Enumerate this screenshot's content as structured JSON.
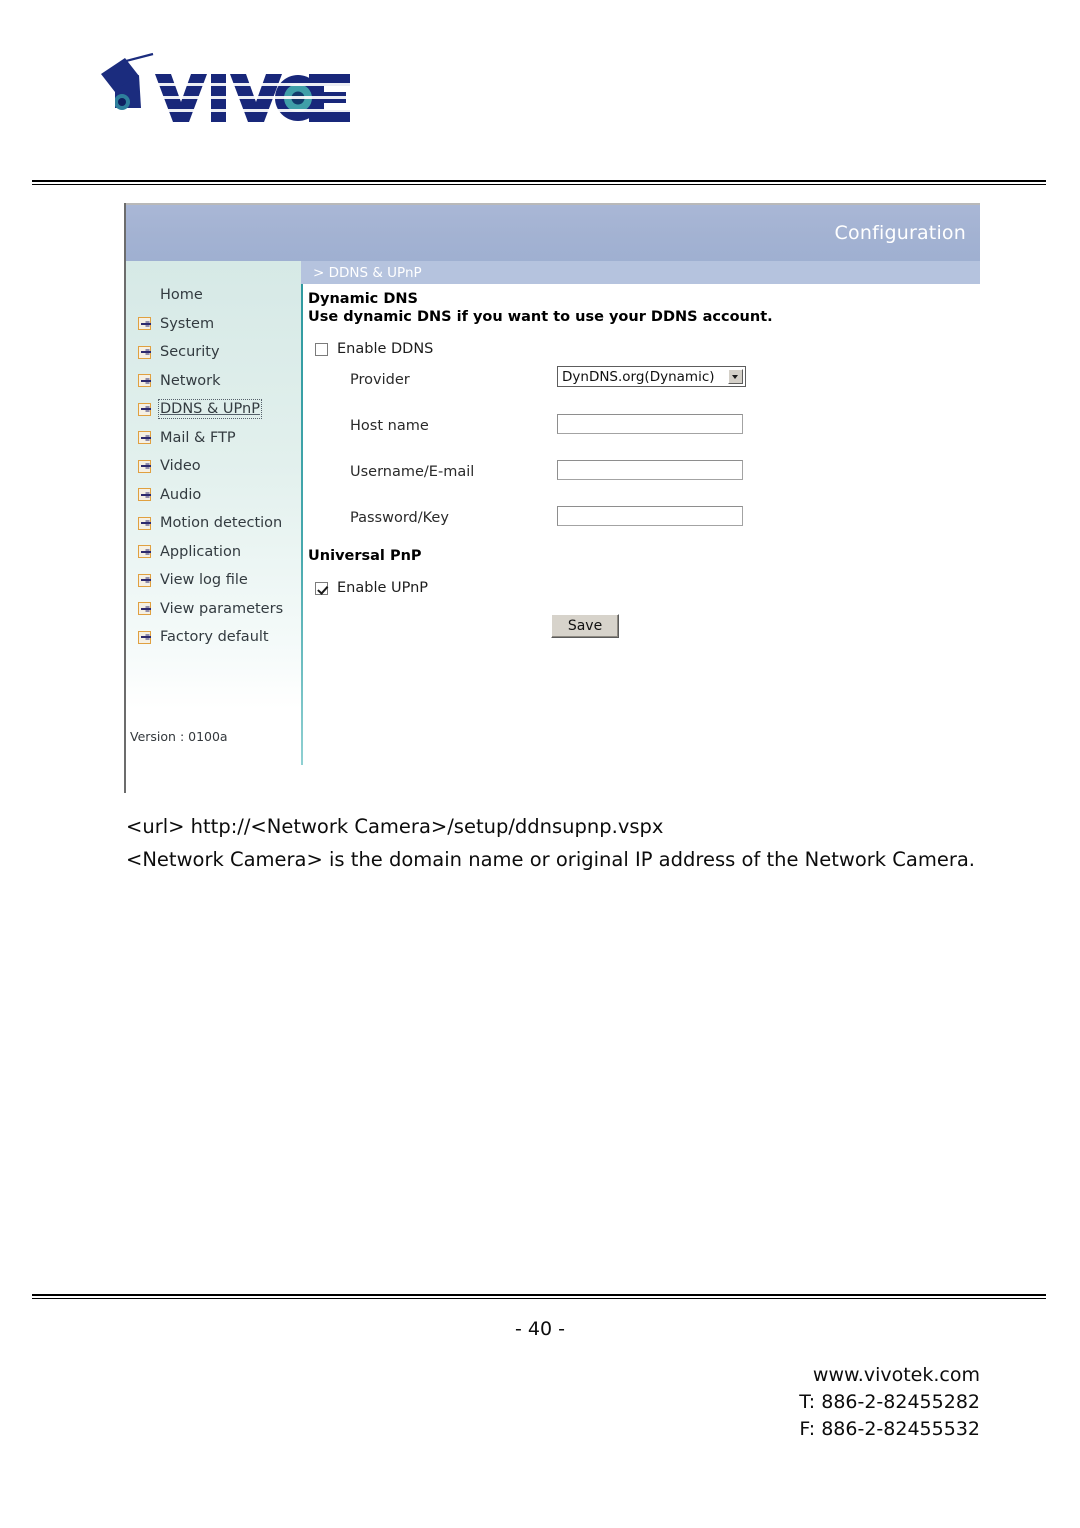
{
  "brand": {
    "logo_text": "VIVOTEK",
    "logo_icon": "vivotek-camera-logo"
  },
  "panel": {
    "titlebar": {
      "title": "Configuration"
    },
    "breadcrumb": {
      "text": "> DDNS & UPnP"
    },
    "sidebar": {
      "items": [
        {
          "label": "Home",
          "has_icon": false,
          "selected": false
        },
        {
          "label": "System",
          "has_icon": true,
          "selected": false
        },
        {
          "label": "Security",
          "has_icon": true,
          "selected": false
        },
        {
          "label": "Network",
          "has_icon": true,
          "selected": false
        },
        {
          "label": "DDNS & UPnP",
          "has_icon": true,
          "selected": true
        },
        {
          "label": "Mail & FTP",
          "has_icon": true,
          "selected": false
        },
        {
          "label": "Video",
          "has_icon": true,
          "selected": false
        },
        {
          "label": "Audio",
          "has_icon": true,
          "selected": false
        },
        {
          "label": "Motion detection",
          "has_icon": true,
          "selected": false
        },
        {
          "label": "Application",
          "has_icon": true,
          "selected": false
        },
        {
          "label": "View log file",
          "has_icon": true,
          "selected": false
        },
        {
          "label": "View parameters",
          "has_icon": true,
          "selected": false
        },
        {
          "label": "Factory default",
          "has_icon": true,
          "selected": false
        }
      ],
      "version": "Version : 0100a"
    },
    "form": {
      "ddns": {
        "heading": "Dynamic DNS",
        "description": "Use dynamic DNS if you want to use your DDNS account.",
        "enable_label": "Enable DDNS",
        "enable_checked": false,
        "fields": [
          {
            "label": "Provider",
            "type": "select",
            "value": "DynDNS.org(Dynamic)"
          },
          {
            "label": "Host name",
            "type": "text",
            "value": "",
            "placeholder": ""
          },
          {
            "label": "Username/E-mail",
            "type": "text",
            "value": "",
            "placeholder": ""
          },
          {
            "label": "Password/Key",
            "type": "text",
            "value": "",
            "placeholder": ""
          }
        ]
      },
      "upnp": {
        "heading": "Universal PnP",
        "enable_label": "Enable UPnP",
        "enable_checked": true
      },
      "save_label": "Save"
    }
  },
  "body_text": {
    "url_line": "<url> http://<Network Camera>/setup/ddnsupnp.vspx",
    "description": "<Network Camera> is the domain name or original IP address of the Network Camera."
  },
  "footer": {
    "page_number": "- 40 -",
    "website": "www.vivotek.com",
    "telephone": "T: 886-2-82455282",
    "fax": "F: 886-2-82455532"
  },
  "colors": {
    "titlebar": "#a3b2d2",
    "breadcrumb": "#b5c3de",
    "sidebar_bg": "#dceeeb",
    "divider_teal": "#2f9aa0",
    "icon_border": "#e0a040",
    "icon_arrow": "#2d2a6e",
    "logo_navy": "#18277a",
    "logo_teal": "#2f9aa0"
  }
}
